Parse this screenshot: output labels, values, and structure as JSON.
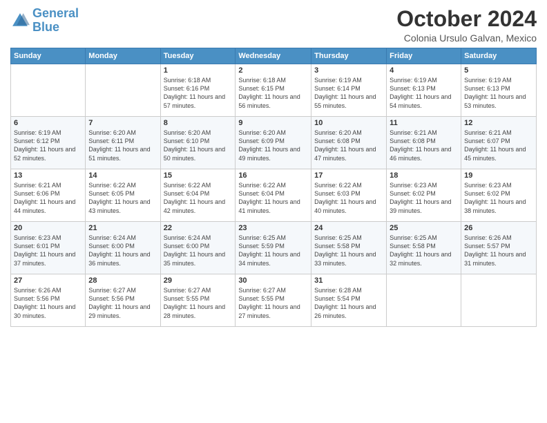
{
  "logo": {
    "line1": "General",
    "line2": "Blue"
  },
  "header": {
    "title": "October 2024",
    "subtitle": "Colonia Ursulo Galvan, Mexico"
  },
  "days_of_week": [
    "Sunday",
    "Monday",
    "Tuesday",
    "Wednesday",
    "Thursday",
    "Friday",
    "Saturday"
  ],
  "weeks": [
    [
      {
        "day": "",
        "info": ""
      },
      {
        "day": "",
        "info": ""
      },
      {
        "day": "1",
        "info": "Sunrise: 6:18 AM\nSunset: 6:16 PM\nDaylight: 11 hours and 57 minutes."
      },
      {
        "day": "2",
        "info": "Sunrise: 6:18 AM\nSunset: 6:15 PM\nDaylight: 11 hours and 56 minutes."
      },
      {
        "day": "3",
        "info": "Sunrise: 6:19 AM\nSunset: 6:14 PM\nDaylight: 11 hours and 55 minutes."
      },
      {
        "day": "4",
        "info": "Sunrise: 6:19 AM\nSunset: 6:13 PM\nDaylight: 11 hours and 54 minutes."
      },
      {
        "day": "5",
        "info": "Sunrise: 6:19 AM\nSunset: 6:13 PM\nDaylight: 11 hours and 53 minutes."
      }
    ],
    [
      {
        "day": "6",
        "info": "Sunrise: 6:19 AM\nSunset: 6:12 PM\nDaylight: 11 hours and 52 minutes."
      },
      {
        "day": "7",
        "info": "Sunrise: 6:20 AM\nSunset: 6:11 PM\nDaylight: 11 hours and 51 minutes."
      },
      {
        "day": "8",
        "info": "Sunrise: 6:20 AM\nSunset: 6:10 PM\nDaylight: 11 hours and 50 minutes."
      },
      {
        "day": "9",
        "info": "Sunrise: 6:20 AM\nSunset: 6:09 PM\nDaylight: 11 hours and 49 minutes."
      },
      {
        "day": "10",
        "info": "Sunrise: 6:20 AM\nSunset: 6:08 PM\nDaylight: 11 hours and 47 minutes."
      },
      {
        "day": "11",
        "info": "Sunrise: 6:21 AM\nSunset: 6:08 PM\nDaylight: 11 hours and 46 minutes."
      },
      {
        "day": "12",
        "info": "Sunrise: 6:21 AM\nSunset: 6:07 PM\nDaylight: 11 hours and 45 minutes."
      }
    ],
    [
      {
        "day": "13",
        "info": "Sunrise: 6:21 AM\nSunset: 6:06 PM\nDaylight: 11 hours and 44 minutes."
      },
      {
        "day": "14",
        "info": "Sunrise: 6:22 AM\nSunset: 6:05 PM\nDaylight: 11 hours and 43 minutes."
      },
      {
        "day": "15",
        "info": "Sunrise: 6:22 AM\nSunset: 6:04 PM\nDaylight: 11 hours and 42 minutes."
      },
      {
        "day": "16",
        "info": "Sunrise: 6:22 AM\nSunset: 6:04 PM\nDaylight: 11 hours and 41 minutes."
      },
      {
        "day": "17",
        "info": "Sunrise: 6:22 AM\nSunset: 6:03 PM\nDaylight: 11 hours and 40 minutes."
      },
      {
        "day": "18",
        "info": "Sunrise: 6:23 AM\nSunset: 6:02 PM\nDaylight: 11 hours and 39 minutes."
      },
      {
        "day": "19",
        "info": "Sunrise: 6:23 AM\nSunset: 6:02 PM\nDaylight: 11 hours and 38 minutes."
      }
    ],
    [
      {
        "day": "20",
        "info": "Sunrise: 6:23 AM\nSunset: 6:01 PM\nDaylight: 11 hours and 37 minutes."
      },
      {
        "day": "21",
        "info": "Sunrise: 6:24 AM\nSunset: 6:00 PM\nDaylight: 11 hours and 36 minutes."
      },
      {
        "day": "22",
        "info": "Sunrise: 6:24 AM\nSunset: 6:00 PM\nDaylight: 11 hours and 35 minutes."
      },
      {
        "day": "23",
        "info": "Sunrise: 6:25 AM\nSunset: 5:59 PM\nDaylight: 11 hours and 34 minutes."
      },
      {
        "day": "24",
        "info": "Sunrise: 6:25 AM\nSunset: 5:58 PM\nDaylight: 11 hours and 33 minutes."
      },
      {
        "day": "25",
        "info": "Sunrise: 6:25 AM\nSunset: 5:58 PM\nDaylight: 11 hours and 32 minutes."
      },
      {
        "day": "26",
        "info": "Sunrise: 6:26 AM\nSunset: 5:57 PM\nDaylight: 11 hours and 31 minutes."
      }
    ],
    [
      {
        "day": "27",
        "info": "Sunrise: 6:26 AM\nSunset: 5:56 PM\nDaylight: 11 hours and 30 minutes."
      },
      {
        "day": "28",
        "info": "Sunrise: 6:27 AM\nSunset: 5:56 PM\nDaylight: 11 hours and 29 minutes."
      },
      {
        "day": "29",
        "info": "Sunrise: 6:27 AM\nSunset: 5:55 PM\nDaylight: 11 hours and 28 minutes."
      },
      {
        "day": "30",
        "info": "Sunrise: 6:27 AM\nSunset: 5:55 PM\nDaylight: 11 hours and 27 minutes."
      },
      {
        "day": "31",
        "info": "Sunrise: 6:28 AM\nSunset: 5:54 PM\nDaylight: 11 hours and 26 minutes."
      },
      {
        "day": "",
        "info": ""
      },
      {
        "day": "",
        "info": ""
      }
    ]
  ]
}
